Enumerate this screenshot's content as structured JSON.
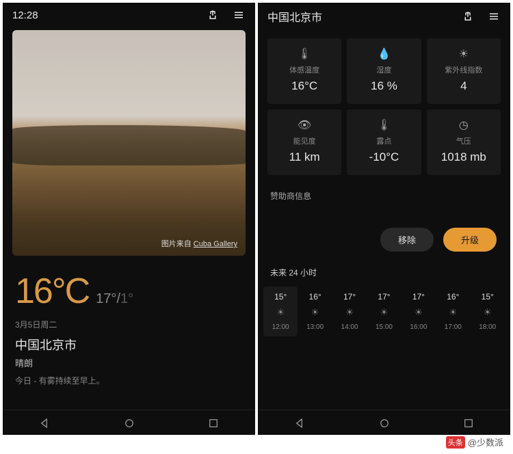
{
  "left": {
    "time": "12:28",
    "photo_credit_prefix": "图片来自 ",
    "photo_credit_source": "Cuba Gallery",
    "temp_main": "16°C",
    "temp_high": "17°",
    "temp_low": "1°",
    "date": "3月5日周二",
    "city": "中国北京市",
    "condition": "晴朗",
    "fog_note": "今日 - 有雾持续至早上。"
  },
  "right": {
    "city": "中国北京市",
    "details": [
      {
        "icon": "thermometer-icon",
        "label": "体感温度",
        "value": "16°C"
      },
      {
        "icon": "humidity-icon",
        "label": "湿度",
        "value": "16 %"
      },
      {
        "icon": "sun-icon",
        "label": "紫外线指数",
        "value": "4"
      },
      {
        "icon": "eye-icon",
        "label": "能见度",
        "value": "11 km"
      },
      {
        "icon": "dewpoint-icon",
        "label": "露点",
        "value": "-10°C"
      },
      {
        "icon": "gauge-icon",
        "label": "气压",
        "value": "1018 mb"
      }
    ],
    "sponsor_label": "赞助商信息",
    "remove_btn": "移除",
    "upgrade_btn": "升级",
    "next24_label": "未来 24 小时",
    "hourly": [
      {
        "temp": "15°",
        "time": "12:00",
        "active": true
      },
      {
        "temp": "16°",
        "time": "13:00",
        "active": false
      },
      {
        "temp": "17°",
        "time": "14:00",
        "active": false
      },
      {
        "temp": "17°",
        "time": "15:00",
        "active": false
      },
      {
        "temp": "17°",
        "time": "16:00",
        "active": false
      },
      {
        "temp": "16°",
        "time": "17:00",
        "active": false
      },
      {
        "temp": "15°",
        "time": "18:00",
        "active": false
      }
    ]
  },
  "watermark": {
    "badge": "头条",
    "text": "@少数派"
  },
  "icon_glyphs": {
    "thermometer-icon": "🌡",
    "humidity-icon": "💧",
    "sun-icon": "☀",
    "eye-icon": "👁",
    "dewpoint-icon": "🌡",
    "gauge-icon": "◷"
  }
}
